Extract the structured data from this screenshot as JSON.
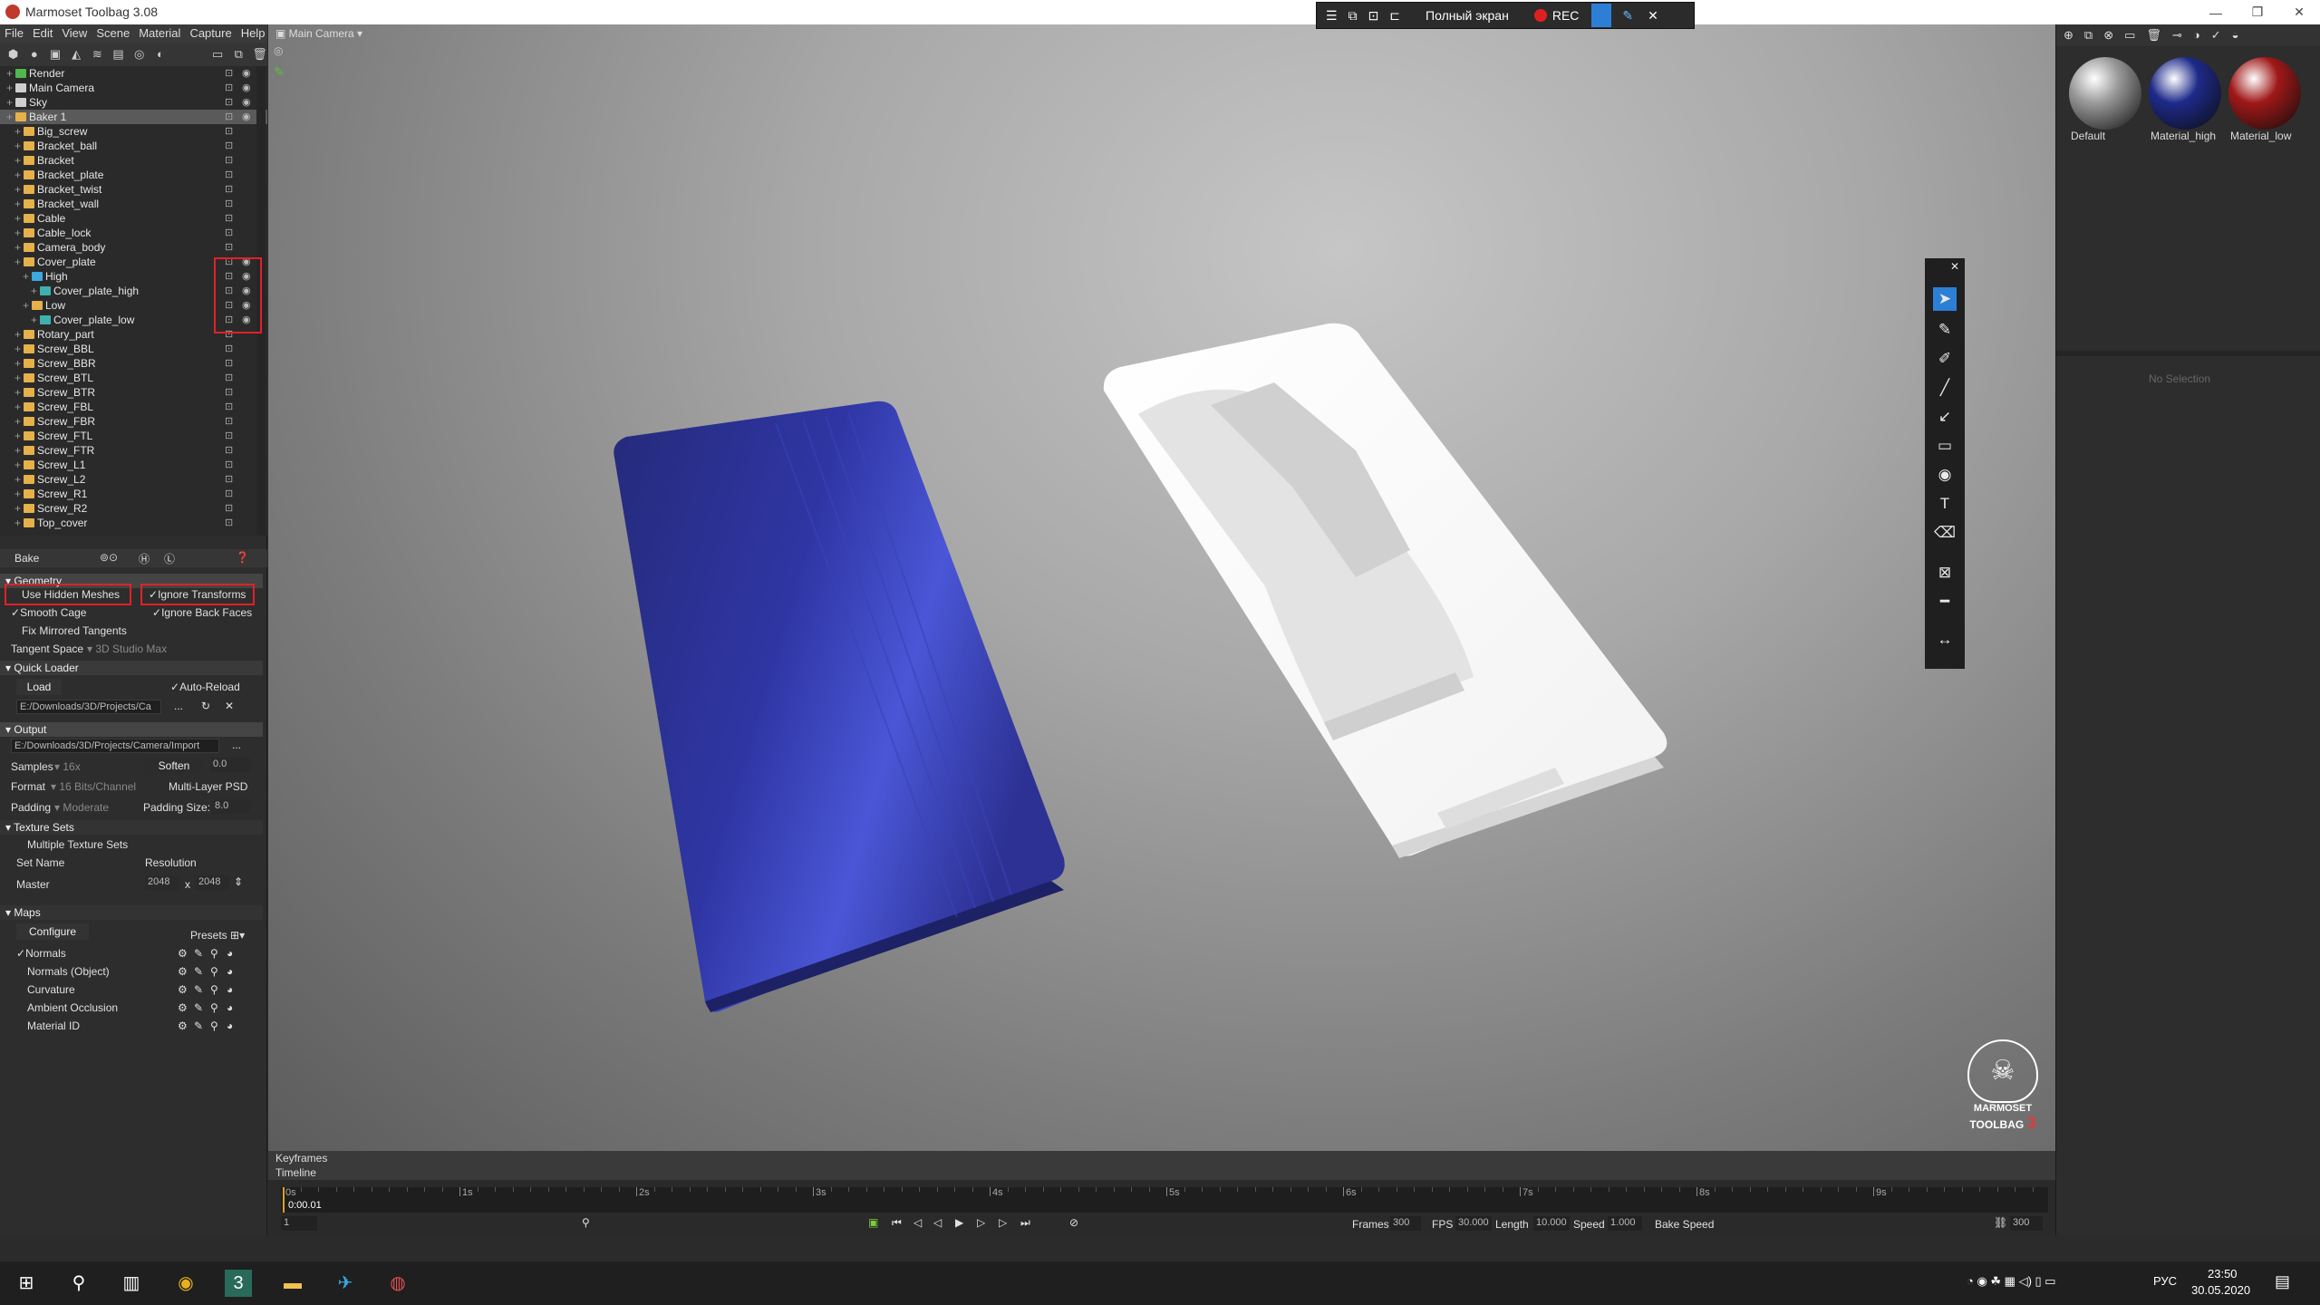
{
  "window": {
    "title": "Marmoset Toolbag 3.08",
    "min": "—",
    "max": "❐",
    "close": "✕"
  },
  "menu": [
    "File",
    "Edit",
    "View",
    "Scene",
    "Material",
    "Capture",
    "Help"
  ],
  "scene_tree": [
    {
      "label": "Render",
      "indent": 1,
      "icon": "render"
    },
    {
      "label": "Main Camera",
      "indent": 1,
      "icon": "camera"
    },
    {
      "label": "Sky",
      "indent": 1,
      "icon": "sky"
    },
    {
      "label": "Baker 1",
      "indent": 1,
      "icon": "folder",
      "selected": true
    },
    {
      "label": "Big_screw",
      "indent": 2,
      "icon": "folder"
    },
    {
      "label": "Bracket_ball",
      "indent": 2,
      "icon": "folder"
    },
    {
      "label": "Bracket",
      "indent": 2,
      "icon": "folder"
    },
    {
      "label": "Bracket_plate",
      "indent": 2,
      "icon": "folder"
    },
    {
      "label": "Bracket_twist",
      "indent": 2,
      "icon": "folder"
    },
    {
      "label": "Bracket_wall",
      "indent": 2,
      "icon": "folder"
    },
    {
      "label": "Cable",
      "indent": 2,
      "icon": "folder"
    },
    {
      "label": "Cable_lock",
      "indent": 2,
      "icon": "folder"
    },
    {
      "label": "Camera_body",
      "indent": 2,
      "icon": "folder"
    },
    {
      "label": "Cover_plate",
      "indent": 2,
      "icon": "folder"
    },
    {
      "label": "High",
      "indent": 3,
      "icon": "high"
    },
    {
      "label": "Cover_plate_high",
      "indent": 4,
      "icon": "mesh"
    },
    {
      "label": "Low",
      "indent": 3,
      "icon": "low"
    },
    {
      "label": "Cover_plate_low",
      "indent": 4,
      "icon": "mesh"
    },
    {
      "label": "Rotary_part",
      "indent": 2,
      "icon": "folder"
    },
    {
      "label": "Screw_BBL",
      "indent": 2,
      "icon": "folder"
    },
    {
      "label": "Screw_BBR",
      "indent": 2,
      "icon": "folder"
    },
    {
      "label": "Screw_BTL",
      "indent": 2,
      "icon": "folder"
    },
    {
      "label": "Screw_BTR",
      "indent": 2,
      "icon": "folder"
    },
    {
      "label": "Screw_FBL",
      "indent": 2,
      "icon": "folder"
    },
    {
      "label": "Screw_FBR",
      "indent": 2,
      "icon": "folder"
    },
    {
      "label": "Screw_FTL",
      "indent": 2,
      "icon": "folder"
    },
    {
      "label": "Screw_FTR",
      "indent": 2,
      "icon": "folder"
    },
    {
      "label": "Screw_L1",
      "indent": 2,
      "icon": "folder"
    },
    {
      "label": "Screw_L2",
      "indent": 2,
      "icon": "folder"
    },
    {
      "label": "Screw_R1",
      "indent": 2,
      "icon": "folder"
    },
    {
      "label": "Screw_R2",
      "indent": 2,
      "icon": "folder"
    },
    {
      "label": "Top_cover",
      "indent": 2,
      "icon": "folder"
    }
  ],
  "bake": {
    "header": "Bake",
    "geometry": "Geometry",
    "use_hidden": "Use Hidden Meshes",
    "ignore_transforms": "Ignore Transforms",
    "smooth_cage": "Smooth Cage",
    "ignore_back": "Ignore Back Faces",
    "fix_mirrored": "Fix Mirrored Tangents",
    "tangent_space_label": "Tangent Space",
    "tangent_space_value": "3D Studio Max",
    "quick_loader": "Quick Loader",
    "load": "Load",
    "auto_reload": "Auto-Reload",
    "loader_path": "E:/Downloads/3D/Projects/Ca",
    "output": "Output",
    "output_path": "E:/Downloads/3D/Projects/Camera/Import",
    "samples_label": "Samples",
    "samples_value": "16x",
    "soften_label": "Soften",
    "soften_value": "0.0",
    "format_label": "Format",
    "format_value": "16 Bits/Channel",
    "multilayer": "Multi-Layer PSD",
    "padding_label": "Padding",
    "padding_value": "Moderate",
    "padding_size_label": "Padding Size:",
    "padding_size_value": "8.0",
    "texture_sets": "Texture Sets",
    "multi_sets": "Multiple Texture Sets",
    "set_name": "Set Name",
    "resolution": "Resolution",
    "master": "Master",
    "res_w": "2048",
    "res_x": "x",
    "res_h": "2048",
    "maps": "Maps",
    "configure": "Configure",
    "presets": "Presets",
    "map_list": [
      "Normals",
      "Normals (Object)",
      "Curvature",
      "Ambient Occlusion",
      "Material ID"
    ]
  },
  "viewport": {
    "camera_label": "Main Camera",
    "logo_line1": "MARMOSET",
    "logo_line2": "TOOLBAG",
    "logo_num": "3"
  },
  "recorder": {
    "fullscreen": "Полный экран",
    "rec": "REC"
  },
  "materials": [
    {
      "name": "Default",
      "color": "#9a9a9a"
    },
    {
      "name": "Material_high",
      "color": "#1e2a8a"
    },
    {
      "name": "Material_low",
      "color": "#a01818"
    }
  ],
  "right_panel": {
    "no_selection": "No Selection"
  },
  "timeline": {
    "keyframes": "Keyframes",
    "timeline": "Timeline",
    "ticks": [
      "0s",
      "1s",
      "2s",
      "3s",
      "4s",
      "5s",
      "6s",
      "7s",
      "8s",
      "9s"
    ],
    "current_time": "0:00.01",
    "frame": "1",
    "frames_label": "Frames",
    "frames_value": "300",
    "fps_label": "FPS",
    "fps_value": "30.000",
    "length_label": "Length",
    "length_value": "10.000",
    "speed_label": "Speed",
    "speed_value": "1.000",
    "bake_speed": "Bake Speed",
    "end_frame": "300"
  },
  "taskbar": {
    "lang": "РУС",
    "time": "23:50",
    "date": "30.05.2020"
  }
}
